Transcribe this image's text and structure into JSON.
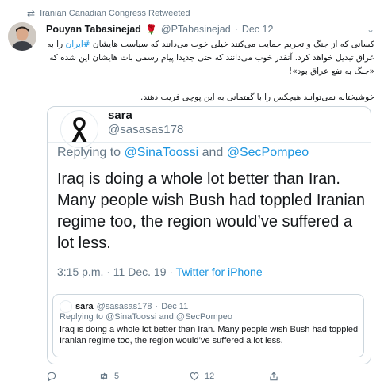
{
  "retweet": {
    "label": "Iranian Canadian Congress Retweeted",
    "icon": "retweet-icon"
  },
  "tweet": {
    "author_name": "Pouyan Tabasinejad",
    "author_emoji": "🌹",
    "handle": "@PTabasinejad",
    "separator": "·",
    "date": "Dec 12",
    "para1_before": "کسانی که از جنگ و تحریم حمایت می‌کنند خیلی خوب می‌دانند که سیاست هایشان ",
    "hashtag": "#ایران",
    "para1_after": " را به عراق تبدیل خواهد کرد. آنقدر خوب می‌دانند که حتی جدیدا پیام رسمی بات هایشان این شده که «جنگ به نفع عراق بود»!",
    "para2": "خوشبختانه نمی‌توانند هیچکس را با گفتمانی به این پوچی فریب دهند."
  },
  "embedded": {
    "name": "sara",
    "handle": "@sasasas178",
    "replying_prefix": "Replying to ",
    "mention1": "@SinaToossi",
    "and": " and ",
    "mention2": "@SecPompeo",
    "text": "Iraq is doing a whole lot better than Iran. Many people wish Bush had toppled Iranian regime too, the region would’ve suffered a lot less.",
    "time": "3:15 p.m. · 11 Dec. 19 · ",
    "source": "Twitter for iPhone"
  },
  "quoted": {
    "name": "sara",
    "handle": "@sasasas178",
    "separator": "·",
    "date": "Dec 11",
    "replying": "Replying to @SinaToossi and @SecPompeo",
    "text": "Iraq is doing a whole lot better than Iran. Many people wish Bush had toppled Iranian regime too, the region would’ve suffered a lot less."
  },
  "actions": {
    "reply_count": "",
    "retweet_count": "5",
    "like_count": "12"
  },
  "colors": {
    "link": "#1b95e0",
    "muted": "#657786",
    "border": "#ccd6dd"
  }
}
